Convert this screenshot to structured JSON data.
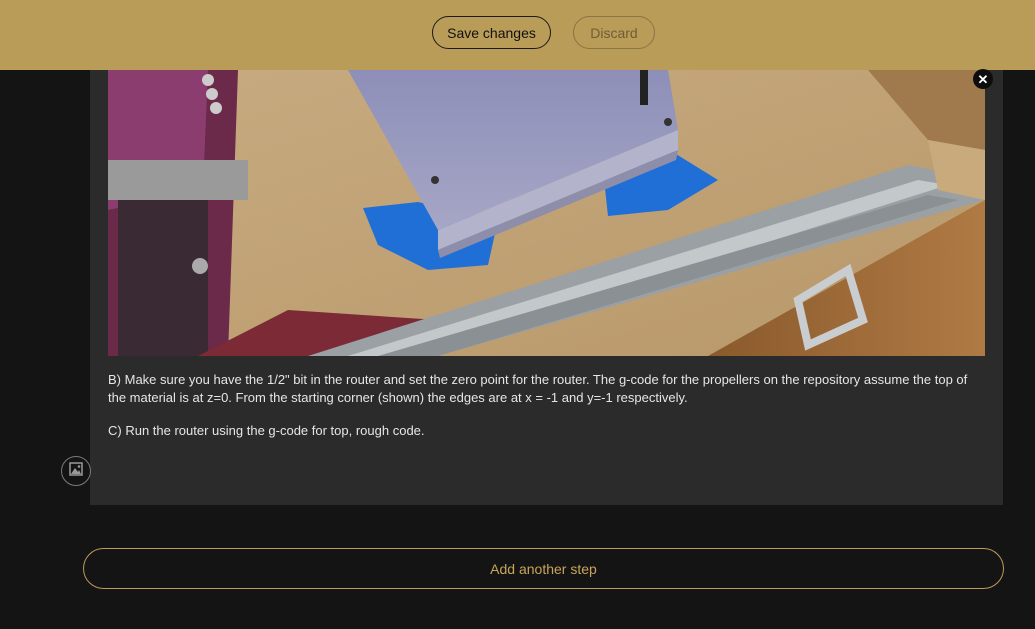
{
  "toolbar": {
    "save_label": "Save changes",
    "discard_label": "Discard"
  },
  "step": {
    "photo_icon": "close-icon",
    "paragraphs": [
      "B) Make sure you have the 1/2\" bit in the router and set the zero point for the router.  The g-code for the propellers on the repository assume the top of the material is at z=0.  From the starting corner (shown) the edges are at x = -1 and y=-1 respectively.",
      "C) Run the router using the g-code for top, rough code."
    ],
    "add_image_icon": "image-icon"
  },
  "footer": {
    "add_step_label": "Add another step"
  },
  "colors": {
    "accent": "#b99c57",
    "background": "#141414",
    "card": "#2b2b2b"
  }
}
